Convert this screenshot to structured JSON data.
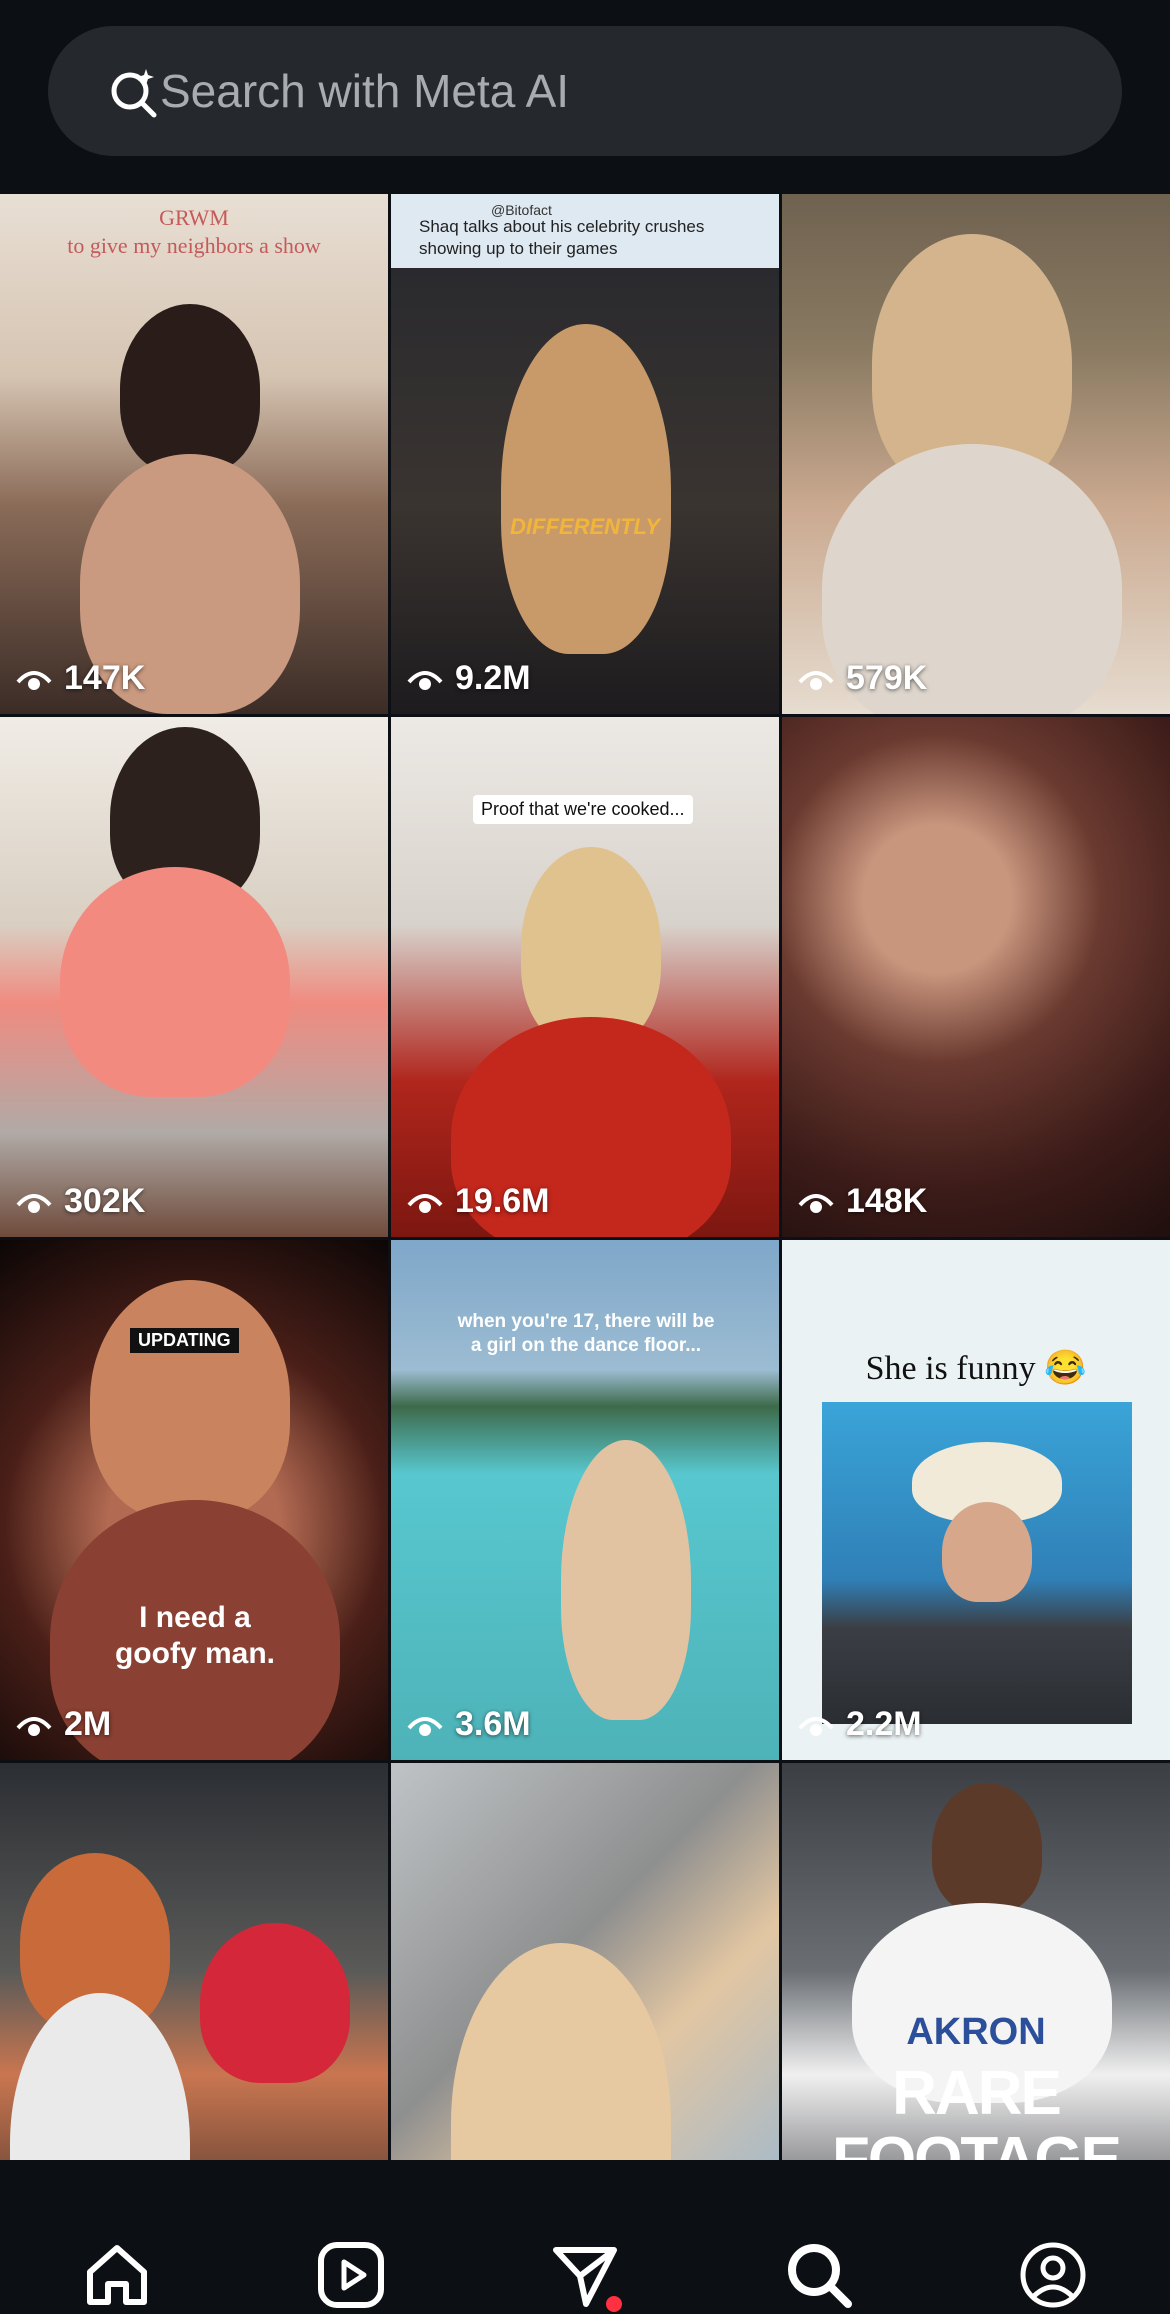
{
  "search": {
    "placeholder": "Search with Meta AI",
    "icon": "meta-ai-search-icon"
  },
  "tiles": [
    {
      "views": "147K",
      "caption": "GRWM\nto give my neighbors a show"
    },
    {
      "views": "9.2M",
      "handle": "@Bitofact",
      "caption": "Shaq talks about his celebrity crushes showing up to their games",
      "overlay": "DIFFERENTLY"
    },
    {
      "views": "579K"
    },
    {
      "views": "302K"
    },
    {
      "views": "19.6M",
      "caption": "Proof that we're cooked..."
    },
    {
      "views": "148K"
    },
    {
      "views": "2M",
      "caption": "I need a goofy man.",
      "badge": "UPDATING"
    },
    {
      "views": "3.6M",
      "caption": "when you're 17, there will be a girl on the dance floor..."
    },
    {
      "views": "2.2M",
      "caption": "She is funny 😂"
    },
    {},
    {},
    {
      "caption": "RARE FOOTAGE OF LEBRON AT",
      "jersey": "AKRON"
    }
  ],
  "nav": {
    "items": [
      "home-icon",
      "reels-icon",
      "direct-messages-icon",
      "search-icon",
      "profile-icon"
    ],
    "notification_color": "#ff3040"
  }
}
